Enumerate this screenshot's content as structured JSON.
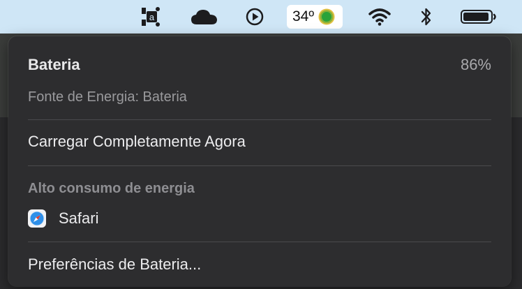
{
  "menubar": {
    "icons": [
      "app-icon",
      "cloud-icon",
      "play-icon",
      "weather-icon",
      "wifi-icon",
      "bluetooth-icon",
      "battery-icon"
    ],
    "weather_temp": "34º"
  },
  "battery_menu": {
    "title": "Bateria",
    "percent": "86%",
    "power_source": "Fonte de Energia: Bateria",
    "charge_action": "Carregar Completamente Agora",
    "high_energy_heading": "Alto consumo de energia",
    "apps": [
      {
        "name": "Safari",
        "icon": "safari-icon"
      }
    ],
    "preferences": "Preferências de Bateria..."
  },
  "colors": {
    "menubar_bg": "#cfe6f6",
    "panel_bg": "#2d2d2f",
    "text_primary": "#ececee",
    "text_secondary": "#9a9a9d"
  }
}
